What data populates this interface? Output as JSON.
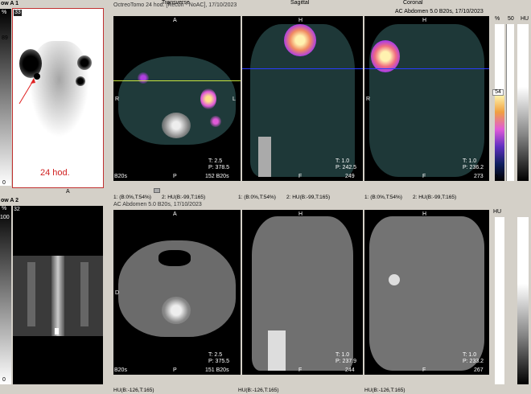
{
  "left_top": {
    "title": "ow A 1",
    "pct": "%",
    "top_value": "33",
    "side_value": "89",
    "zero": "0",
    "annotation": "24 hod."
  },
  "left_bottom": {
    "title": "ow A 2",
    "pct": "%",
    "top_value": "32",
    "side_value": "100",
    "zero": "0"
  },
  "top_row": {
    "left_title": "OctreoTomo 24 hod. [Recon - NoAC], 17/10/2023",
    "center_title": "Transverse",
    "mid_title": "Sagittal",
    "right_title": "Coronal",
    "right_series": "AC  Abdomen  5.0  B20s, 17/10/2023",
    "transverse": {
      "ori_top": "A",
      "ori_bottom": "P",
      "ori_left": "R",
      "ori_right": "L",
      "t": "T: 2.5",
      "p": "P: 378.5",
      "footer_left": "B20s",
      "footer_right": "152 B20s"
    },
    "sagittal": {
      "ori_top": "H",
      "ori_bottom": "F",
      "t": "T: 1.0",
      "p": "P: 242.5",
      "footer_right": "249"
    },
    "coronal": {
      "ori_top": "H",
      "ori_bottom": "F",
      "ori_left": "R",
      "t": "T: 1.0",
      "p": "P: 236.2",
      "footer_right": "273"
    },
    "status": [
      "1: (B:0%,T:54%)",
      "2: HU(B:-99,T:165)",
      "1: (B:0%,T:54%)",
      "2: HU(B:-99,T:165)",
      "1: (B:0%,T:54%)",
      "2: HU(B:-99,T:165)"
    ]
  },
  "bottom_row": {
    "left_title": "AC  Abdomen  5.0  B20s, 17/10/2023",
    "transverse": {
      "ori_top": "A",
      "ori_bottom": "P",
      "ori_left": "D",
      "t": "T: 2.5",
      "p": "P: 375.5",
      "footer_left": "B20s",
      "footer_right": "151 B20s"
    },
    "sagittal": {
      "ori_top": "H",
      "ori_bottom": "F",
      "t": "T: 1.0",
      "p": "P: 237.9",
      "footer_right": "244"
    },
    "coronal": {
      "ori_top": "H",
      "ori_bottom": "F",
      "t": "T: 1.0",
      "p": "P: 233.2",
      "footer_right": "267"
    },
    "status": [
      "HU(B:-126,T:165)",
      "HU(B:-126,T:165)",
      "HU(B:-126,T:165)"
    ]
  },
  "scale_top": {
    "pct": "%",
    "top": "50",
    "hu": "HU",
    "value": "54",
    "zero": "0"
  },
  "scale_bottom": {
    "hu": "HU"
  },
  "colors": {
    "pet_hot": "#ffe08a",
    "pet_mid": "#e05ad8",
    "frame_red": "#c03030",
    "crosshair": "#2a3cff",
    "crosshair_green": "#c8e640"
  }
}
